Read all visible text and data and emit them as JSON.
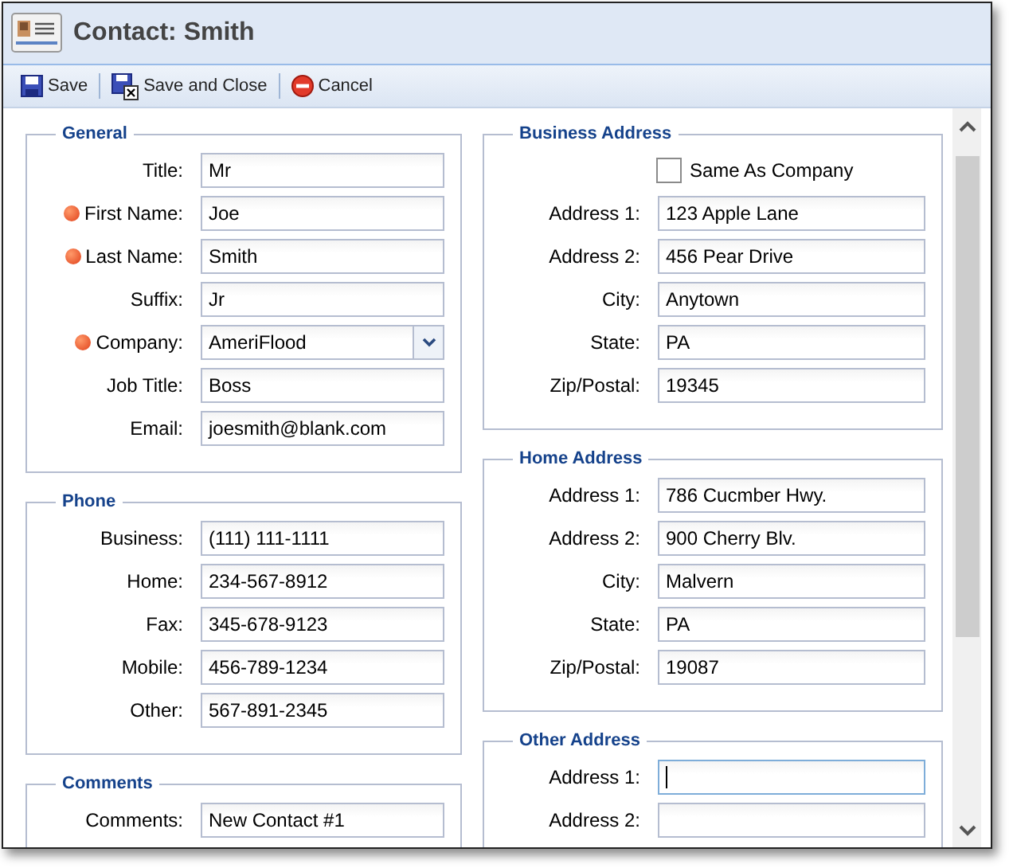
{
  "window": {
    "title": "Contact: Smith"
  },
  "toolbar": [
    {
      "label": "Save",
      "kind": "save"
    },
    {
      "label": "Save and Close",
      "kind": "save-close"
    },
    {
      "label": "Cancel",
      "kind": "cancel"
    }
  ],
  "left_column": [
    {
      "title": "General",
      "fields": [
        {
          "label": "Title:",
          "value": "Mr",
          "kind": "text",
          "required": false
        },
        {
          "label": "First Name:",
          "value": "Joe",
          "kind": "text",
          "required": true
        },
        {
          "label": "Last Name:",
          "value": "Smith",
          "kind": "text",
          "required": true
        },
        {
          "label": "Suffix:",
          "value": "Jr",
          "kind": "text",
          "required": false
        },
        {
          "label": "Company:",
          "value": "AmeriFlood",
          "kind": "select",
          "required": true
        },
        {
          "label": "Job Title:",
          "value": "Boss",
          "kind": "text",
          "required": false
        },
        {
          "label": "Email:",
          "value": "joesmith@blank.com",
          "kind": "text",
          "required": false
        }
      ]
    },
    {
      "title": "Phone",
      "fields": [
        {
          "label": "Business:",
          "value": "(111) 111-1111",
          "kind": "text",
          "required": false
        },
        {
          "label": "Home:",
          "value": "234-567-8912",
          "kind": "text",
          "required": false
        },
        {
          "label": "Fax:",
          "value": "345-678-9123",
          "kind": "text",
          "required": false
        },
        {
          "label": "Mobile:",
          "value": "456-789-1234",
          "kind": "text",
          "required": false
        },
        {
          "label": "Other:",
          "value": "567-891-2345",
          "kind": "text",
          "required": false
        }
      ]
    },
    {
      "title": "Comments",
      "fields": [
        {
          "label": "Comments:",
          "value": "New Contact #1",
          "kind": "textarea",
          "required": false
        }
      ]
    }
  ],
  "right_column": [
    {
      "title": "Business Address",
      "fields": [
        {
          "label": "Same As Company",
          "kind": "checkbox",
          "checked": false
        },
        {
          "label": "Address 1:",
          "value": "123 Apple Lane",
          "kind": "text"
        },
        {
          "label": "Address 2:",
          "value": "456 Pear Drive",
          "kind": "text"
        },
        {
          "label": "City:",
          "value": "Anytown",
          "kind": "text"
        },
        {
          "label": "State:",
          "value": "PA",
          "kind": "text"
        },
        {
          "label": "Zip/Postal:",
          "value": "19345",
          "kind": "text"
        }
      ]
    },
    {
      "title": "Home Address",
      "fields": [
        {
          "label": "Address 1:",
          "value": "786 Cucmber Hwy.",
          "kind": "text"
        },
        {
          "label": "Address 2:",
          "value": "900 Cherry Blv.",
          "kind": "text"
        },
        {
          "label": "City:",
          "value": "Malvern",
          "kind": "text"
        },
        {
          "label": "State:",
          "value": "PA",
          "kind": "text"
        },
        {
          "label": "Zip/Postal:",
          "value": "19087",
          "kind": "text"
        }
      ]
    },
    {
      "title": "Other Address",
      "fields": [
        {
          "label": "Address 1:",
          "kind": "text",
          "focused": true
        },
        {
          "label": "Address 2:",
          "kind": "text"
        }
      ]
    }
  ]
}
